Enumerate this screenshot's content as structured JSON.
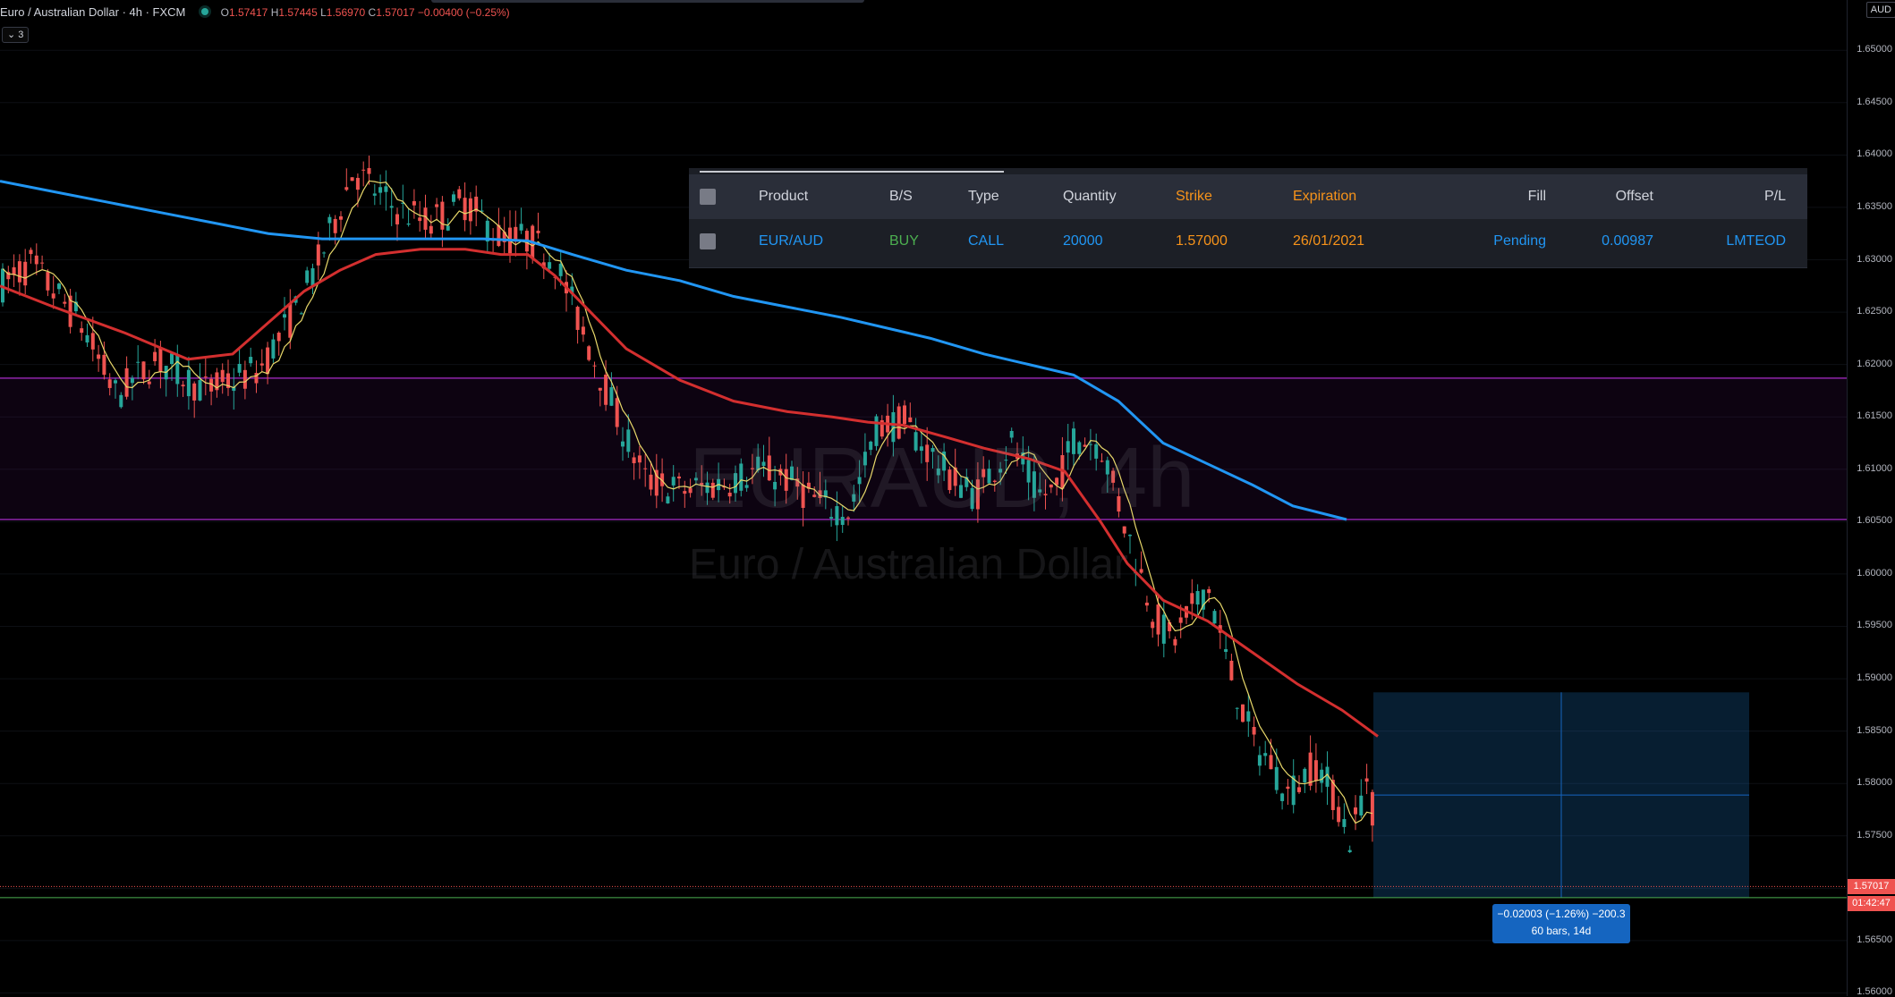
{
  "legend": {
    "symbol": "Euro / Australian Dollar · 4h · FXCM",
    "open_label": "O",
    "open": "1.57417",
    "high_label": "H",
    "high": "1.57445",
    "low_label": "L",
    "low": "1.56970",
    "close_label": "C",
    "close": "1.57017",
    "change": "−0.00400 (−0.25%)",
    "indicators_toggle": "⌄ 3"
  },
  "watermark": {
    "line1": "EURAUD, 4h",
    "line2": "Euro / Australian Dollar"
  },
  "price_axis": {
    "currency": "AUD",
    "ticks": [
      "1.65000",
      "1.64500",
      "1.64000",
      "1.63500",
      "1.63000",
      "1.62500",
      "1.62000",
      "1.61500",
      "1.61000",
      "1.60500",
      "1.60000",
      "1.59500",
      "1.59000",
      "1.58500",
      "1.58000",
      "1.57500",
      "1.57000",
      "1.56500",
      "1.56000"
    ],
    "last_price": "1.57017",
    "countdown": "01:42:47"
  },
  "order_panel": {
    "headers": {
      "product": "Product",
      "bs": "B/S",
      "type": "Type",
      "quantity": "Quantity",
      "strike": "Strike",
      "expiration": "Expiration",
      "fill": "Fill",
      "offset": "Offset",
      "pl": "P/L"
    },
    "row": {
      "product": "EUR/AUD",
      "bs": "BUY",
      "type": "CALL",
      "quantity": "20000",
      "strike": "1.57000",
      "expiration": "26/01/2021",
      "fill": "Pending",
      "offset": "0.00987",
      "pl": "LMTEOD"
    }
  },
  "measure": {
    "line1": "−0.02003 (−1.26%) −200.3",
    "line2": "60 bars, 14d"
  },
  "colors": {
    "up": "#26a69a",
    "down": "#ef5350",
    "ma_fast": "#e8d86a",
    "ma_mid": "#d32f2f",
    "ma_slow": "#2196f3",
    "zone": "#7b1fa2"
  },
  "chart_data": {
    "type": "candlestick",
    "symbol": "EURAUD",
    "interval": "4h",
    "ylim": [
      1.56,
      1.655
    ],
    "zone": [
      1.6052,
      1.6187
    ],
    "ma_slow_end": 1.6052,
    "ma_mid_end": 1.5845,
    "last_close": 1.57017,
    "measure_from": 1.5887,
    "measure_to": 1.5691
  }
}
